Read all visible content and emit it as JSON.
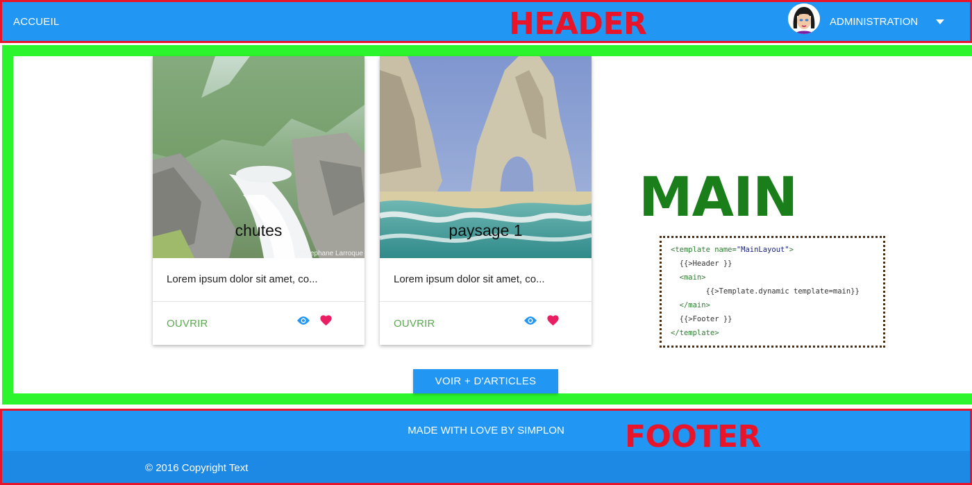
{
  "header": {
    "home_label": "ACCUEIL",
    "overlay_label": "HEADER",
    "admin_label": "ADMINISTRATION"
  },
  "main": {
    "overlay_label": "MAIN",
    "cards": [
      {
        "title": "chutes",
        "credit": "©Stephane Larroque",
        "text": "Lorem ipsum dolor sit amet, co...",
        "open_label": "OUVRIR"
      },
      {
        "title": "paysage 1",
        "text": "Lorem ipsum dolor sit amet, co...",
        "open_label": "OUVRIR"
      }
    ],
    "more_button": "VOIR + D'ARTICLES",
    "code": {
      "line1_open": "<template ",
      "line1_attr": "name=",
      "line1_value": "\"MainLayout\"",
      "line1_close": ">",
      "line2": "  {{>Header }}",
      "line3": "  <main>",
      "line4": "        {{>Template.dynamic template=main}}",
      "line5": "  </main>",
      "line6": "  {{>Footer }}",
      "line7": "</template>"
    }
  },
  "footer": {
    "tagline": "MADE WITH LOVE BY SIMPLON",
    "copyright": "© 2016 Copyright Text",
    "overlay_label": "FOOTER"
  },
  "colors": {
    "primary": "#2196f3",
    "header_footer_outline": "#e8142a",
    "main_outline": "#2df52d",
    "main_label": "#1a7f1a",
    "open_link": "#5aa94f",
    "eye_icon": "#2196f3",
    "heart_icon": "#e91e63"
  },
  "icons": [
    "avatar",
    "chevron-down-icon",
    "eye-icon",
    "heart-icon"
  ]
}
